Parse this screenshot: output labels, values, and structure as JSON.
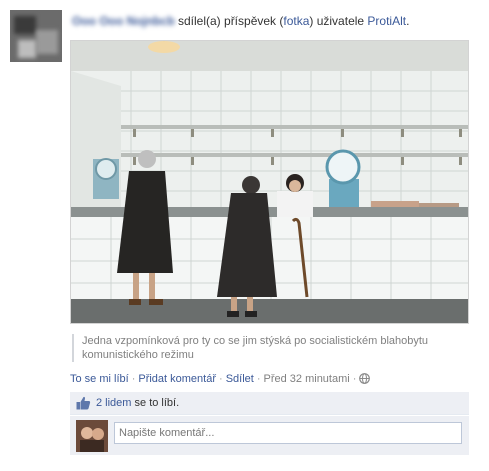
{
  "post": {
    "author_name": "Ooo Ooo Nojnbcb",
    "shared_text": "sdílel(a) příspěvek (",
    "photo_link": "fotka",
    "owner_prefix": ") uživatele ",
    "page_name": "ProtiAlt",
    "period": "."
  },
  "caption": "Jedna vzpomínková pro ty co se jim stýská po socialistickém blahobytu komunistického režimu",
  "actions": {
    "like": "To se mi líbí",
    "sep": "·",
    "comment": "Přidat komentář",
    "share": "Sdílet",
    "time": "Před 32 minutami"
  },
  "likes": {
    "count_link": "2 lidem",
    "suffix": " se to líbí."
  },
  "comment_box": {
    "placeholder": "Napište komentář..."
  },
  "icons": {
    "like": "thumbs-up-icon",
    "privacy": "globe-icon"
  },
  "colors": {
    "link": "#3b5998",
    "meta": "#808080",
    "ufi_bg": "#edeff4"
  }
}
